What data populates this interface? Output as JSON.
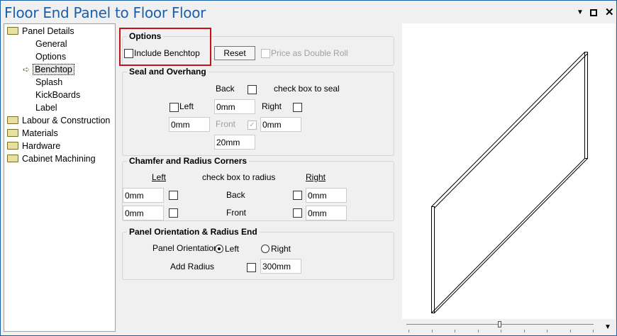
{
  "window": {
    "title": "Floor End Panel to Floor Floor",
    "menu_icon": "dropdown-arrow-icon",
    "maximize_icon": "maximize-icon",
    "close_icon": "close-icon"
  },
  "tree": {
    "items": [
      {
        "label": "Panel Details",
        "type": "folder"
      },
      {
        "label": "General",
        "type": "child"
      },
      {
        "label": "Options",
        "type": "child"
      },
      {
        "label": "Benchtop",
        "type": "child",
        "selected": true
      },
      {
        "label": "Splash",
        "type": "child"
      },
      {
        "label": "KickBoards",
        "type": "child"
      },
      {
        "label": "Label",
        "type": "child"
      },
      {
        "label": "Labour & Construction",
        "type": "folder"
      },
      {
        "label": "Materials",
        "type": "folder"
      },
      {
        "label": "Hardware",
        "type": "folder"
      },
      {
        "label": "Cabinet Machining",
        "type": "folder"
      }
    ]
  },
  "options": {
    "title": "Options",
    "include_benchtop": "Include Benchtop",
    "include_checked": false,
    "reset": "Reset",
    "price_double_roll": "Price as Double Roll"
  },
  "seal": {
    "title": "Seal and Overhang",
    "back": "Back",
    "check_hint": "check box to seal",
    "left": "Left",
    "right": "Right",
    "front": "Front",
    "back_value": "0mm",
    "left_value": "0mm",
    "right_value": "0mm",
    "front_value": "20mm",
    "front_checked": true
  },
  "chamfer": {
    "title": "Chamfer and Radius Corners",
    "left": "Left",
    "right": "Right",
    "check_hint": "check box to radius",
    "back": "Back",
    "front": "Front",
    "left_back": "0mm",
    "left_front": "0mm",
    "right_back": "0mm",
    "right_front": "0mm"
  },
  "orientation": {
    "title": "Panel Orientation & Radius End",
    "orientation_label": "Panel Orientation",
    "left": "Left",
    "right": "Right",
    "selected": "Left",
    "add_radius": "Add Radius",
    "radius_value": "300mm"
  },
  "preview": {
    "zoom_slider_value": 0.5,
    "colors": {
      "highlight": "#c0141c",
      "title": "#1c5fa8"
    }
  }
}
